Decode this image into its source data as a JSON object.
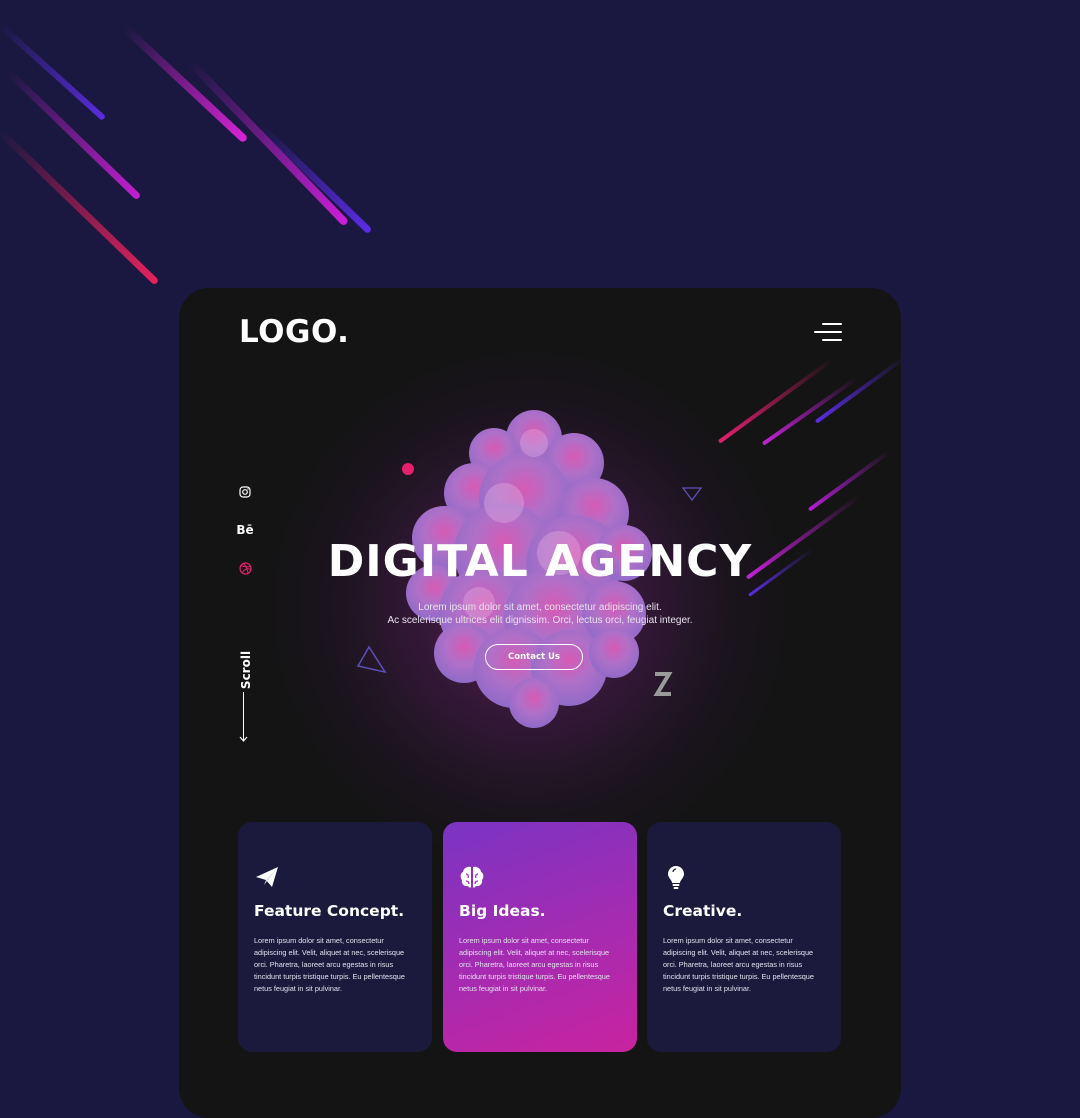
{
  "header": {
    "logo": "LOGO.",
    "menu_icon": "hamburger-menu-icon"
  },
  "social": {
    "items": [
      {
        "icon": "instagram-icon"
      },
      {
        "label": "Bē",
        "icon": "behance-icon"
      },
      {
        "icon": "dribbble-icon"
      }
    ]
  },
  "scroll": {
    "label": "Scroll",
    "icon": "arrow-down-icon"
  },
  "hero": {
    "title": "DIGITAL AGENCY",
    "subtitle_line1": "Lorem ipsum dolor sit amet, consectetur adipiscing elit.",
    "subtitle_line2": "Ac scelerisque ultrices elit dignissim. Orci, lectus orci, feugiat integer.",
    "cta_label": "Contact Us"
  },
  "cards": [
    {
      "icon": "paper-plane-icon",
      "title": "Feature Concept.",
      "body": "Lorem ipsum dolor sit amet, consectetur adipiscing elit. Velit, aliquet at nec, scelerisque orci. Pharetra, laoreet arcu egestas in risus tincidunt turpis tristique turpis. Eu pellentesque netus feugiat in sit pulvinar."
    },
    {
      "icon": "brain-icon",
      "title": "Big Ideas.",
      "body": "Lorem ipsum dolor sit amet, consectetur adipiscing elit. Velit, aliquet at nec, scelerisque orci. Pharetra, laoreet arcu egestas in risus tincidunt turpis tristique turpis. Eu pellentesque netus feugiat in sit pulvinar."
    },
    {
      "icon": "lightbulb-icon",
      "title": "Creative.",
      "body": "Lorem ipsum dolor sit amet, consectetur adipiscing elit. Velit, aliquet at nec, scelerisque orci. Pharetra, laoreet arcu egestas in risus tincidunt turpis tristique turpis. Eu pellentesque netus feugiat in sit pulvinar."
    }
  ],
  "colors": {
    "page_background": "#1a1840",
    "frame_background": "#141414",
    "card_background": "#1b1a3d",
    "accent_pink": "#e6206f",
    "accent_purple": "#7a34c4",
    "accent_magenta": "#c9239f"
  }
}
